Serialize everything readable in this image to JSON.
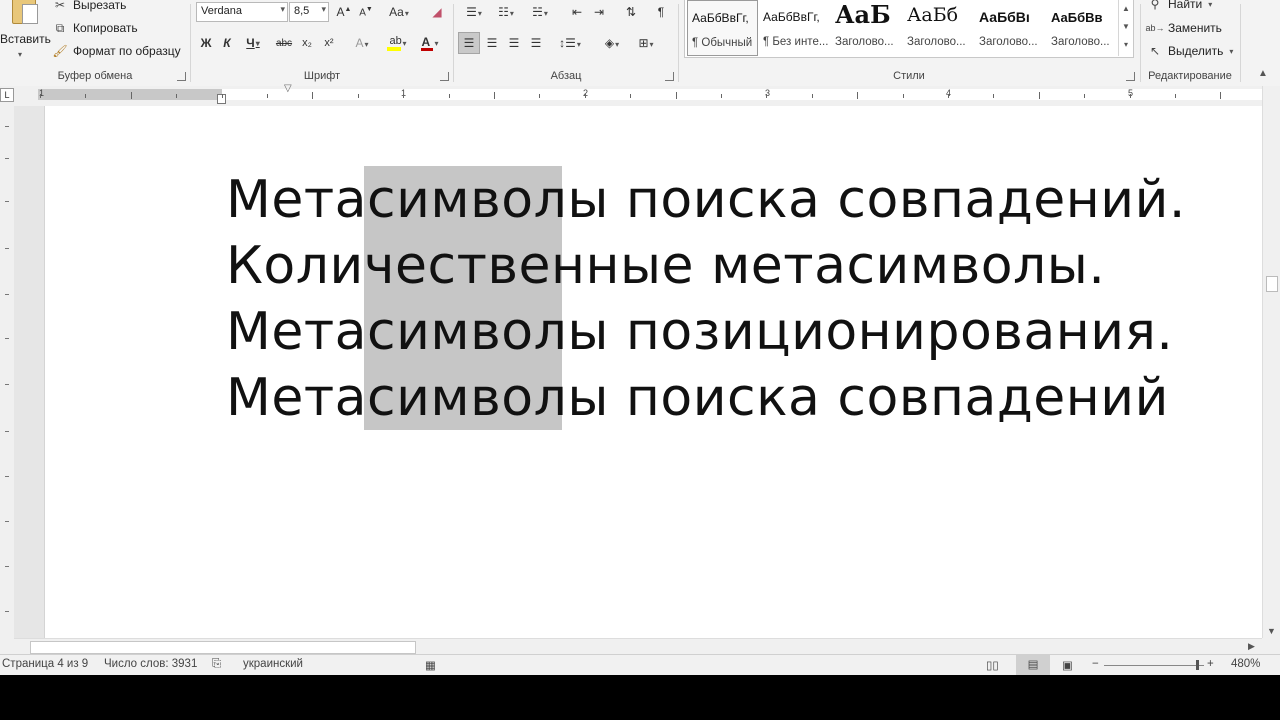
{
  "ribbon": {
    "clipboard": {
      "paste_label": "Вставить",
      "cut_label": "Вырезать",
      "copy_label": "Копировать",
      "format_painter_label": "Формат по образцу",
      "group_label": "Буфер обмена"
    },
    "font": {
      "font_name": "Verdana",
      "font_size": "8,5",
      "bold": "Ж",
      "italic": "К",
      "underline": "Ч",
      "strike": "abc",
      "subscript": "x₂",
      "superscript": "x²",
      "group_label": "Шрифт",
      "font_color": "#c00000",
      "highlight_color": "#ffff00"
    },
    "paragraph": {
      "group_label": "Абзац",
      "show_marks": "¶"
    },
    "styles": {
      "group_label": "Стили",
      "items": [
        {
          "sample": "АаБбВвГг,",
          "name": "¶ Обычный"
        },
        {
          "sample": "АаБбВвГг,",
          "name": "¶ Без инте..."
        },
        {
          "sample": "АаБ",
          "name": "Заголово..."
        },
        {
          "sample": "АаБб",
          "name": "Заголово..."
        },
        {
          "sample": "АаБбВı",
          "name": "Заголово..."
        },
        {
          "sample": "АаБбВв",
          "name": "Заголово..."
        }
      ]
    },
    "editing": {
      "find_label": "Найти",
      "replace_label": "Заменить",
      "select_label": "Выделить",
      "group_label": "Редактирование"
    }
  },
  "ruler": {
    "numbers": [
      "1",
      "1",
      "2",
      "3",
      "4",
      "5"
    ]
  },
  "document": {
    "lines": [
      "Метасимволы поиска совпадений.",
      "Количественные метасимволы.",
      "Метасимволы позиционирования.",
      "Метасимволы поиска совпадений"
    ]
  },
  "status": {
    "page": "Страница 4 из 9",
    "words": "Число слов: 3931",
    "language": "украинский",
    "zoom": "480%"
  }
}
